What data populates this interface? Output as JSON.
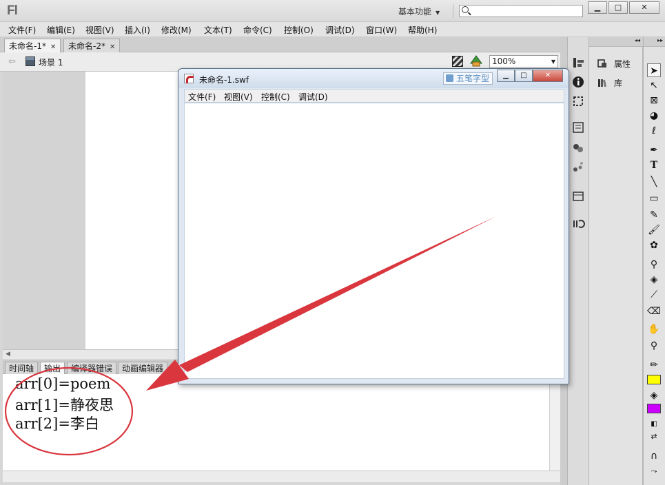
{
  "app": {
    "logo": "Fl",
    "workspace": "基本功能",
    "search": {
      "value": "",
      "placeholder": ""
    }
  },
  "menu": [
    "文件(F)",
    "编辑(E)",
    "视图(V)",
    "插入(I)",
    "修改(M)",
    "文本(T)",
    "命令(C)",
    "控制(O)",
    "调试(D)",
    "窗口(W)",
    "帮助(H)"
  ],
  "doc_tabs": [
    {
      "label": "未命名-1*",
      "active": true
    },
    {
      "label": "未命名-2*",
      "active": false
    }
  ],
  "editbar": {
    "scene": "场景 1",
    "zoom": "100%"
  },
  "panel_tabs": [
    {
      "label": "时间轴",
      "active": false
    },
    {
      "label": "输出",
      "active": true
    },
    {
      "label": "编译器错误",
      "active": false
    },
    {
      "label": "动画编辑器",
      "active": false
    }
  ],
  "output_lines": [
    "arr[0]=poem",
    "arr[1]=静夜思",
    "arr[2]=李白"
  ],
  "props_panel": {
    "properties": "属性",
    "library": "库"
  },
  "swf_window": {
    "title": "未命名-1.swf",
    "ime": "五笔字型",
    "menu": [
      "文件(F)",
      "视图(V)",
      "控制(C)",
      "调试(D)"
    ]
  },
  "colors": {
    "stroke": "#ffff00",
    "fill": "#cc00ff",
    "annotation": "#d9363e"
  }
}
